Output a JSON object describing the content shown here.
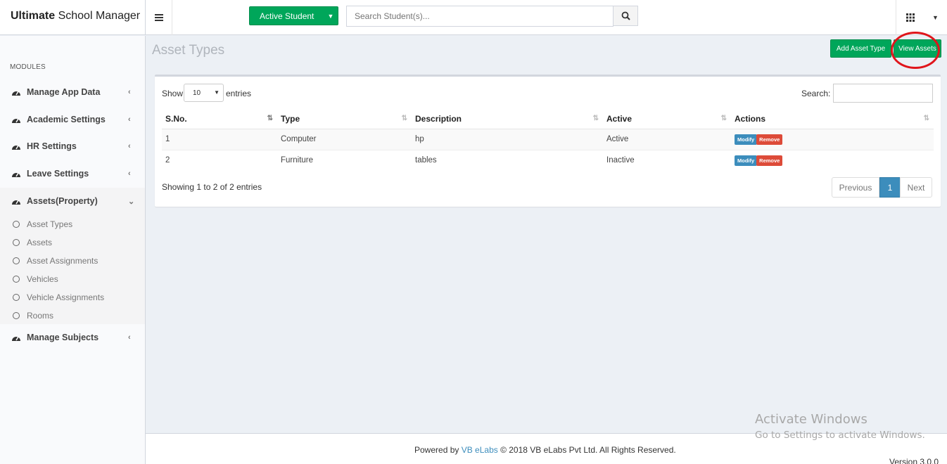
{
  "app": {
    "brand_bold": "Ultimate",
    "brand_rest": " School Manager",
    "student_dropdown": "Active Student",
    "search_placeholder": "Search Student(s)...",
    "version": "Version 3.0.0"
  },
  "sidebar": {
    "header": "MODULES",
    "items": [
      {
        "label": "Manage App Data"
      },
      {
        "label": "Academic Settings"
      },
      {
        "label": "HR Settings"
      },
      {
        "label": "Leave Settings"
      },
      {
        "label": "Assets(Property)"
      },
      {
        "label": "Manage Subjects"
      }
    ],
    "sub_items": [
      {
        "label": "Asset Types"
      },
      {
        "label": "Assets"
      },
      {
        "label": "Asset Assignments"
      },
      {
        "label": "Vehicles"
      },
      {
        "label": "Vehicle Assignments"
      },
      {
        "label": "Rooms"
      }
    ]
  },
  "page": {
    "title": "Asset Types",
    "add_button": "Add Asset Type",
    "view_button": "View Assets"
  },
  "table": {
    "show_label": "Show",
    "page_length": "10",
    "entries_label": "entries",
    "search_label": "Search:",
    "columns": [
      "S.No.",
      "Type",
      "Description",
      "Active",
      "Actions"
    ],
    "rows": [
      {
        "sno": "1",
        "type": "Computer",
        "description": "hp",
        "active": "Active",
        "modify": "Modify",
        "remove": "Remove"
      },
      {
        "sno": "2",
        "type": "Furniture",
        "description": "tables",
        "active": "Inactive",
        "modify": "Modify",
        "remove": "Remove"
      }
    ],
    "info": "Showing 1 to 2 of 2 entries",
    "pagination": {
      "previous": "Previous",
      "current": "1",
      "next": "Next"
    }
  },
  "footer": {
    "powered_by": "Powered by ",
    "company_link": "VB eLabs",
    "copyright": " © 2018 VB eLabs Pvt Ltd. All Rights Reserved."
  },
  "watermark": {
    "line1": "Activate Windows",
    "line2": "Go to Settings to activate Windows."
  },
  "colors": {
    "green": "#00a65a",
    "blue": "#3c8dbc",
    "red": "#dd4b39",
    "highlight": "#e0151b"
  },
  "icons": [
    "bars-icon",
    "caret-down-icon",
    "search-icon",
    "th-icon",
    "dashboard-icon",
    "chevron-left-icon",
    "chevron-down-icon",
    "circle-icon",
    "sort-icon",
    "sort-asc-icon"
  ]
}
